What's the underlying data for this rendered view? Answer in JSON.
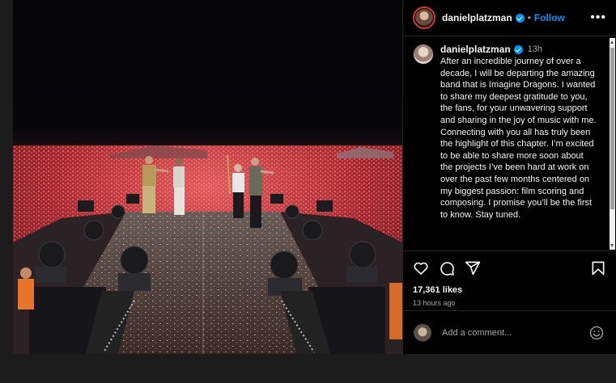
{
  "post": {
    "username": "danielplatzman",
    "follow_label": "Follow",
    "separator": "•",
    "more_label": "•••",
    "time_ago_short": "13h",
    "caption": "After an incredible journey of over a decade, I will be departing the amazing band that is Imagine Dragons. I wanted to share my deepest gratitude to you, the fans, for your unwavering support and sharing in the joy of music with me. Connecting with you all has truly been the highlight of this chapter. I’m excited to be able to share more soon about the projects I’ve been hard at work on over the past few months centered on my biggest passion: film scoring and composing. I promise you’ll be the first to know. Stay tuned.",
    "likes": "17,361 likes",
    "time_ago_long": "13 hours ago"
  },
  "comment": {
    "placeholder": "Add a comment..."
  },
  "icons": {
    "like": "heart-icon",
    "comment": "comment-icon",
    "share": "share-icon",
    "save": "bookmark-icon",
    "emoji": "emoji-icon",
    "verified": "verified-badge-icon"
  },
  "colors": {
    "background": "#000000",
    "accent": "#0095f6",
    "border": "#262626",
    "secondary_text": "#a8a8a8",
    "crowd": "#b8323a"
  }
}
